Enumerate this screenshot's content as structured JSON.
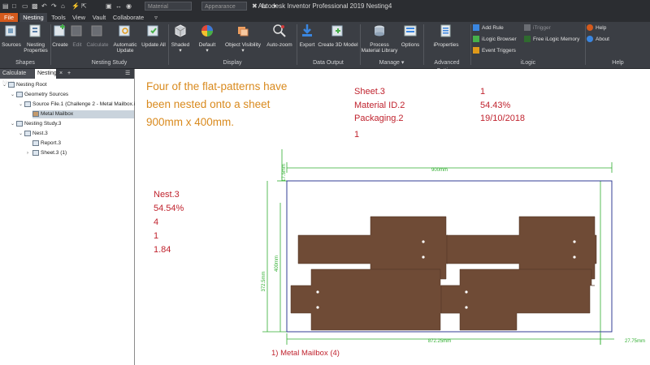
{
  "titlebar": {
    "app_title": "Autodesk Inventor Professional 2019    Nesting4",
    "material_placeholder": "Material",
    "appearance_placeholder": "Appearance"
  },
  "tabs": [
    "File",
    "Nesting",
    "Tools",
    "View",
    "Vault",
    "Collaborate"
  ],
  "ribbon": {
    "groups": {
      "shapes": "Shapes",
      "nesting_study": "Nesting Study",
      "display": "Display",
      "data_output": "Data Output",
      "manage": "Manage ▾",
      "advanced_settings": "Advanced Settings",
      "ilogic": "iLogic",
      "help": "Help"
    },
    "buttons": {
      "sources": "Sources",
      "nesting_properties": "Nesting\nProperties",
      "create": "Create",
      "edit": "Edit",
      "calculate": "Calculate",
      "automatic_update": "Automatic\nUpdate",
      "update_all": "Update All",
      "shaded": "Shaded",
      "default": "Default",
      "object_visibility": "Object Visibility",
      "auto_zoom": "Auto-zoom",
      "export": "Export",
      "create_3d_model": "Create 3D Model",
      "process_material_library": "Process\nMaterial Library",
      "options": "Options",
      "iproperties": "iProperties"
    },
    "ilogic_items": {
      "add_rule": "Add Rule",
      "itrigger": "iTrigger",
      "ilogic_browser": "iLogic Browser",
      "free_ilogic_memory": "Free iLogic Memory",
      "event_triggers": "Event Triggers"
    },
    "help_items": {
      "help": "Help",
      "about": "About"
    }
  },
  "browser": {
    "tabs": [
      "Calculate Nest",
      "Nesting"
    ],
    "add_tab": "+",
    "menu": "☰",
    "tree": [
      "Nesting Root",
      "Geometry Sources",
      "Source File.1 (Challenge 2 - Metal Mailbox.ipt)",
      "Metal Mailbox",
      "Nesting Study.3",
      "Nest.3",
      "Report.3",
      "Sheet.3 (1)"
    ]
  },
  "canvas": {
    "note": "Four of the flat-patterns have been nested onto a sheet 900mm x 400mm.",
    "sheet_info": {
      "labels": [
        "Sheet.3",
        "Material ID.2",
        "Packaging.2"
      ],
      "values": [
        "1",
        "54.43%",
        "19/10/2018"
      ],
      "count": "1"
    },
    "nest_info": [
      "Nest.3",
      "54.54%",
      "4",
      "1",
      "1.84"
    ],
    "dimensions": {
      "width": "900mm",
      "height": "400mm",
      "top_margin": "17.5mm",
      "inner_height": "372.5mm",
      "used_width": "872.25mm",
      "right_margin": "27.75mm"
    },
    "part_label": "1) Metal Mailbox (4)"
  },
  "colors": {
    "part_fill": "#6f4b36",
    "dimension": "#2fae2f",
    "sheet_outline": "#1d2a8a",
    "annotation_red": "#c0232e",
    "annotation_orange": "#d98a1e",
    "file_tab": "#d55a1c"
  }
}
